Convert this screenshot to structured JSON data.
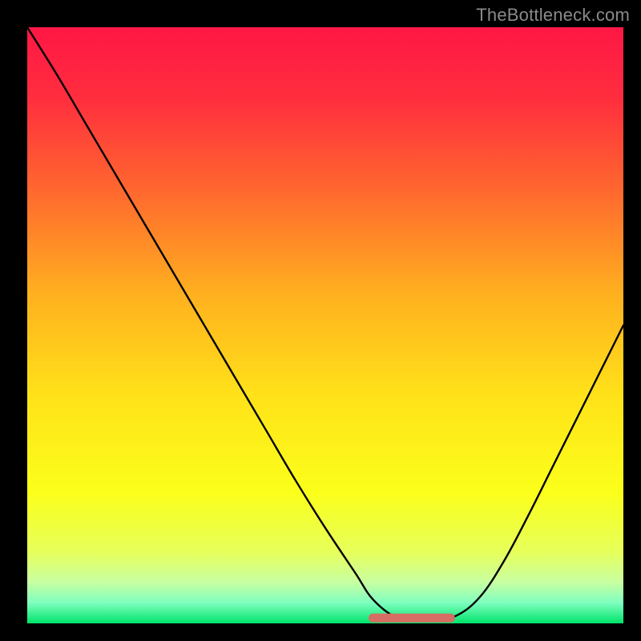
{
  "watermark": "TheBottleneck.com",
  "colors": {
    "black": "#000000",
    "wm": "#8a8a8a",
    "curve": "#000000",
    "marker": "#d66e63"
  },
  "gradient_stops": [
    {
      "offset": 0.0,
      "color": "#ff1745"
    },
    {
      "offset": 0.12,
      "color": "#ff2e3e"
    },
    {
      "offset": 0.28,
      "color": "#ff6a2e"
    },
    {
      "offset": 0.45,
      "color": "#ffb11f"
    },
    {
      "offset": 0.62,
      "color": "#ffe219"
    },
    {
      "offset": 0.78,
      "color": "#fbff1a"
    },
    {
      "offset": 0.88,
      "color": "#e6ff5a"
    },
    {
      "offset": 0.93,
      "color": "#c9ffa0"
    },
    {
      "offset": 0.965,
      "color": "#80ffc0"
    },
    {
      "offset": 1.0,
      "color": "#00e36a"
    }
  ],
  "chart_data": {
    "type": "line",
    "title": "",
    "xlabel": "",
    "ylabel": "",
    "xlim": [
      0,
      100
    ],
    "ylim": [
      0,
      100
    ],
    "annotations": [
      "TheBottleneck.com"
    ],
    "x": [
      0,
      5,
      10,
      15,
      20,
      25,
      30,
      35,
      40,
      45,
      50,
      55,
      58,
      62,
      65,
      68,
      72,
      76,
      80,
      84,
      88,
      92,
      96,
      100
    ],
    "values": [
      100,
      92,
      83.5,
      75,
      66.5,
      58,
      49.5,
      41,
      32.5,
      24,
      16,
      8.5,
      4,
      0.9,
      0.5,
      0.6,
      1.3,
      4.5,
      10.5,
      18,
      26,
      34,
      42,
      50
    ],
    "flat_region": {
      "x_start": 58,
      "x_end": 71,
      "y": 0.9
    }
  }
}
